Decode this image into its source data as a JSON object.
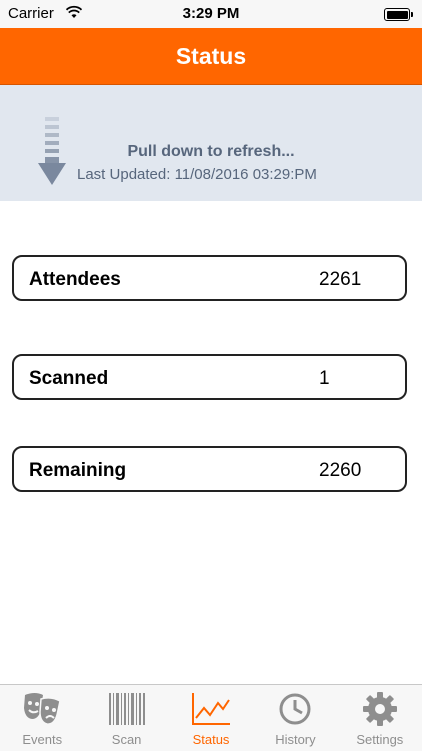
{
  "status_bar": {
    "carrier": "Carrier",
    "time": "3:29 PM"
  },
  "nav": {
    "title": "Status"
  },
  "refresh": {
    "pull_text": "Pull down to refresh...",
    "last_updated": "Last Updated: 11/08/2016 03:29:PM"
  },
  "stats": [
    {
      "label": "Attendees",
      "value": "2261"
    },
    {
      "label": "Scanned",
      "value": "1"
    },
    {
      "label": "Remaining",
      "value": "2260"
    }
  ],
  "tabs": [
    {
      "label": "Events",
      "icon": "theater-masks-icon"
    },
    {
      "label": "Scan",
      "icon": "barcode-icon"
    },
    {
      "label": "Status",
      "icon": "line-chart-icon",
      "active": true
    },
    {
      "label": "History",
      "icon": "clock-icon"
    },
    {
      "label": "Settings",
      "icon": "gear-icon"
    }
  ],
  "colors": {
    "accent": "#ff6600",
    "refresh_bg": "#e1e7ef",
    "refresh_text": "#57667c",
    "tab_inactive": "#8e8e8e"
  }
}
